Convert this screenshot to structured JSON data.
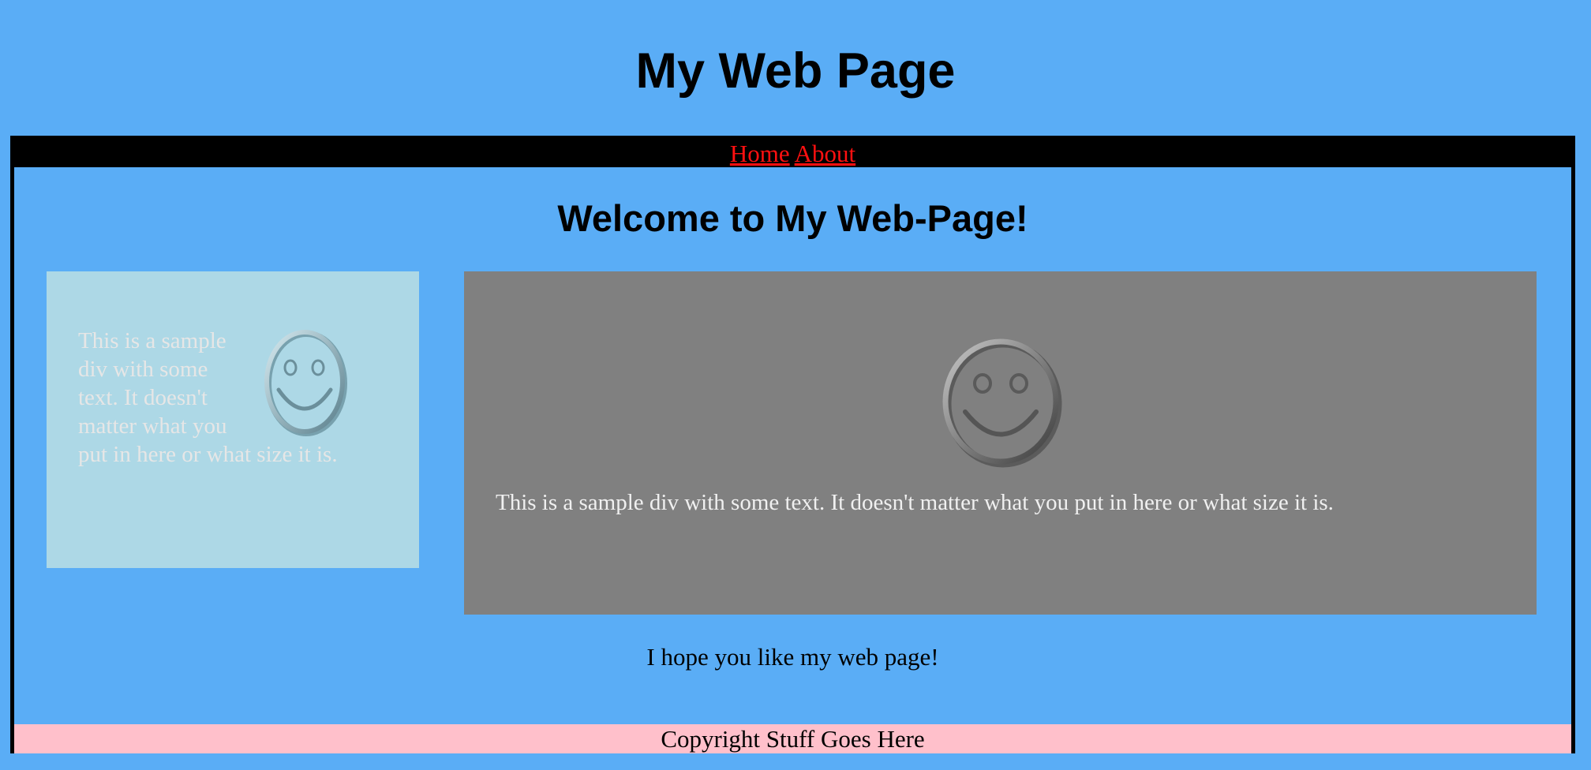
{
  "header": {
    "title": "My Web Page"
  },
  "nav": {
    "items": [
      {
        "label": "Home"
      },
      {
        "label": "About"
      }
    ],
    "link_color": "#ff1010"
  },
  "main": {
    "heading": "Welcome to My Web-Page!",
    "cards": [
      {
        "text": "This is a sample div with some text. It doesn't matter what you put in here or what size it is.",
        "icon": "smiley-icon",
        "background": "#add8e6"
      },
      {
        "text": "This is a sample div with some text. It doesn't matter what you put in here or what size it is.",
        "icon": "smiley-icon",
        "background": "#808080"
      }
    ],
    "closing": "I hope you like my web page!"
  },
  "footer": {
    "text": "Copyright Stuff Goes Here",
    "background": "#ffc0cb"
  },
  "colors": {
    "page_background": "#5aadf6"
  }
}
